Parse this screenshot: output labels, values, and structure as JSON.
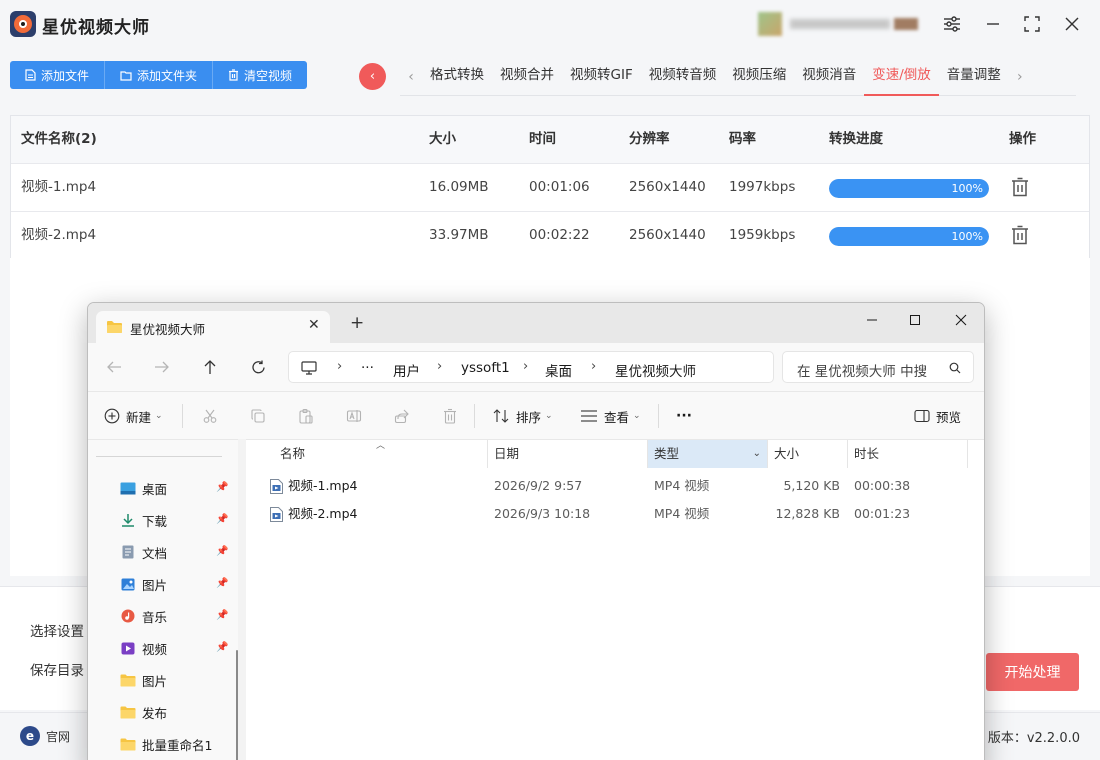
{
  "app": {
    "title": "星优视频大师",
    "toolbar": {
      "add_file": "添加文件",
      "add_folder": "添加文件夹",
      "clear_videos": "清空视频"
    },
    "tabs": [
      "格式转换",
      "视频合并",
      "视频转GIF",
      "视频转音频",
      "视频压缩",
      "视频消音",
      "变速/倒放",
      "音量调整"
    ],
    "active_tab": "变速/倒放",
    "table": {
      "headers": {
        "name": "文件名称(2)",
        "size": "大小",
        "time": "时间",
        "resolution": "分辨率",
        "bitrate": "码率",
        "progress": "转换进度",
        "actions": "操作"
      },
      "rows": [
        {
          "name": "视频-1.mp4",
          "size": "16.09MB",
          "time": "00:01:06",
          "resolution": "2560x1440",
          "bitrate": "1997kbps",
          "progress": 1.0,
          "progress_label": "100%"
        },
        {
          "name": "视频-2.mp4",
          "size": "33.97MB",
          "time": "00:02:22",
          "resolution": "2560x1440",
          "bitrate": "1959kbps",
          "progress": 1.0,
          "progress_label": "100%"
        }
      ]
    },
    "settings": {
      "select_label": "选择设置",
      "save_dir_label": "保存目录"
    },
    "start_button": "开始处理",
    "footer": {
      "site_label": "官网",
      "site_icon_letter": "e",
      "version": "版本：v2.2.0.0"
    },
    "colors": {
      "accent_blue": "#3a8ef0",
      "accent_red": "#f05a5a"
    }
  },
  "explorer": {
    "tab_title": "星优视频大师",
    "breadcrumb": {
      "ellipsis": "···",
      "items": [
        "用户",
        "yssoft1",
        "桌面",
        "星优视频大师"
      ]
    },
    "search_placeholder": "在 星优视频大师 中搜",
    "commands": {
      "new": "新建",
      "sort": "排序",
      "view": "查看",
      "more": "···",
      "preview": "预览"
    },
    "nav": [
      {
        "label": "桌面",
        "icon": "desktop-icon",
        "pinned": true
      },
      {
        "label": "下载",
        "icon": "download-icon",
        "pinned": true
      },
      {
        "label": "文档",
        "icon": "document-icon",
        "pinned": true
      },
      {
        "label": "图片",
        "icon": "picture-icon",
        "pinned": true
      },
      {
        "label": "音乐",
        "icon": "music-icon",
        "pinned": true
      },
      {
        "label": "视频",
        "icon": "video-icon",
        "pinned": true
      },
      {
        "label": "图片",
        "icon": "folder-icon",
        "pinned": false
      },
      {
        "label": "发布",
        "icon": "folder-icon",
        "pinned": false
      },
      {
        "label": "批量重命名1",
        "icon": "folder-icon",
        "pinned": false
      }
    ],
    "columns": {
      "name": "名称",
      "date": "日期",
      "type": "类型",
      "size": "大小",
      "duration": "时长"
    },
    "files": [
      {
        "name": "视频-1.mp4",
        "date": "2026/9/2 9:57",
        "type": "MP4 视频",
        "size": "5,120 KB",
        "duration": "00:00:38"
      },
      {
        "name": "视频-2.mp4",
        "date": "2026/9/3 10:18",
        "type": "MP4 视频",
        "size": "12,828 KB",
        "duration": "00:01:23"
      }
    ]
  }
}
